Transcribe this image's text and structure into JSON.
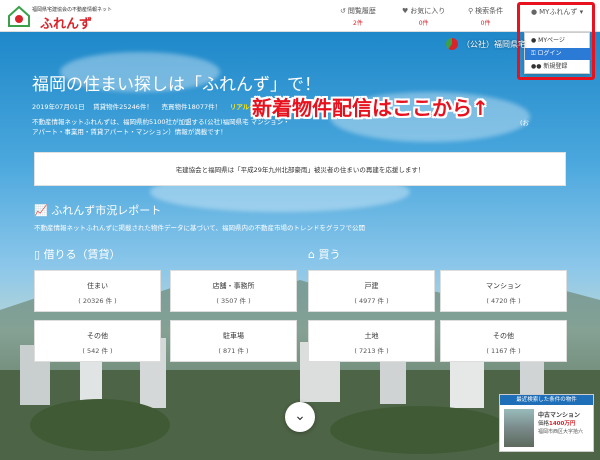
{
  "header": {
    "logo": {
      "tagline": "福岡県宅建協会の不動産情報ネット",
      "name": "ふれんず"
    },
    "nav": [
      {
        "icon": "history-icon",
        "label": "閲覧履歴",
        "count": "2件"
      },
      {
        "icon": "heart-icon",
        "label": "お気に入り",
        "count": "0件"
      },
      {
        "icon": "search-icon",
        "label": "検索条件",
        "count": "0件"
      }
    ],
    "account": {
      "label": "MYふれんず"
    }
  },
  "dropdown": {
    "items": [
      {
        "icon": "user-icon",
        "label": "MYページ"
      },
      {
        "icon": "key-icon",
        "label": "ログイン"
      },
      {
        "icon": "users-icon",
        "label": "新規登録"
      }
    ]
  },
  "association": {
    "text": "（公社）福岡県宅"
  },
  "hero": {
    "title": "福岡の住まい探しは「ふれんず」で！",
    "stats_date": "2019年07月01日",
    "stats_rent": "賃貸物件25246件！",
    "stats_sale": "売買物件18077件！",
    "stats_realtime": "リアルタ",
    "intro": "不動産情報ネットふれんずは、福岡県約5100社が加盟する(公社)福岡県宅 マンション・アパート・事業用・賃貸アパート・マンション）情報が満載です！",
    "intro_tail": "(お"
  },
  "callout": "新着物件配信はここから↑",
  "notice": "宅建協会と福岡県は「平成29年九州北部豪雨」被災者の住まいの再建を応援します！",
  "report": {
    "title": "ふれんず市況レポート",
    "description": "不動産情報ネットふれんずに掲載された物件データに基づいて、福岡県内の不動産市場のトレンドをグラフで公開"
  },
  "rent": {
    "title": "借りる（賃貸）",
    "cards": [
      {
        "label": "住まい",
        "count": "( 20326 件 )"
      },
      {
        "label": "店舗・事務所",
        "count": "( 3507 件 )"
      },
      {
        "label": "その他",
        "count": "( 542 件 )"
      },
      {
        "label": "駐車場",
        "count": "( 871 件 )"
      }
    ]
  },
  "buy": {
    "title": "買う",
    "cards": [
      {
        "label": "戸建",
        "count": "( 4977 件 )"
      },
      {
        "label": "マンション",
        "count": "( 4720 件 )"
      },
      {
        "label": "土地",
        "count": "( 7213 件 )"
      },
      {
        "label": "その他",
        "count": "( 1167 件 )"
      }
    ]
  },
  "recent": {
    "header": "最近検索した条件の物件",
    "name": "中古マンション",
    "price_prefix": "価格",
    "price": "1400万円",
    "address": "福岡市西区大字拾六"
  },
  "colors": {
    "brand_red": "#d8232a",
    "highlight_red": "#e8121f",
    "dropdown_active": "#2a7ad6"
  }
}
